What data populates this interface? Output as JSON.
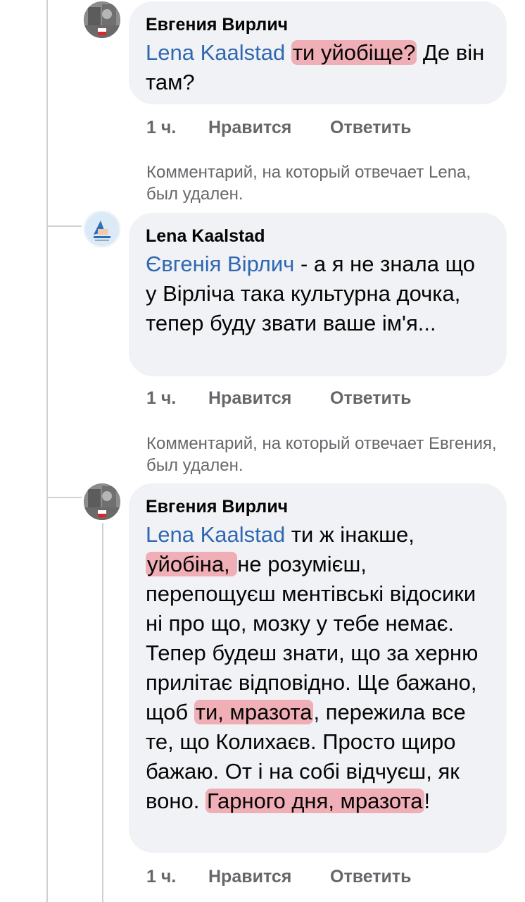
{
  "comments": [
    {
      "author": "Евгения Вирлич",
      "mention": "Lena Kaalstad",
      "segments": [
        "ти уйобіще?",
        " Де він там?"
      ],
      "time": "1 ч.",
      "like_label": "Нравится",
      "reply_label": "Ответить"
    },
    {
      "deleted_notice": "Комментарий, на который отвечает Lena, был удален.",
      "author": "Lena Kaalstad",
      "mention": "Євгенія Вірлич",
      "text": " - а я не знала що у Вірліча така культурна дочка, тепер буду звати ваше ім'я...",
      "time": "1 ч.",
      "like_label": "Нравится",
      "reply_label": "Ответить"
    },
    {
      "deleted_notice": "Комментарий, на который отвечает Евгения, был удален.",
      "author": "Евгения Вирлич",
      "mention": "Lena Kaalstad",
      "segments": [
        " ти ж інакше, ",
        "уйобіна, ",
        "не розумієш, перепощуєш ментівські відосики ні про що, мозку у тебе немає. Тепер будеш знати, що за херню прилітає відповідно. Ще бажано, щоб ",
        "ти, мразота",
        ", пережила все те, що Колихаєв. Просто щиро бажаю. От і на собі відчуєш, як воно. ",
        "Гарного дня, мразота",
        "!"
      ],
      "time": "1 ч.",
      "like_label": "Нравится",
      "reply_label": "Ответить"
    }
  ],
  "colors": {
    "bubble": "#f0f2f5",
    "mention": "#2f67b2",
    "highlight": "#f0505f",
    "meta_text": "#65676b"
  },
  "icons": [
    "profile-photo-yevheniia",
    "profile-photo-lena"
  ]
}
